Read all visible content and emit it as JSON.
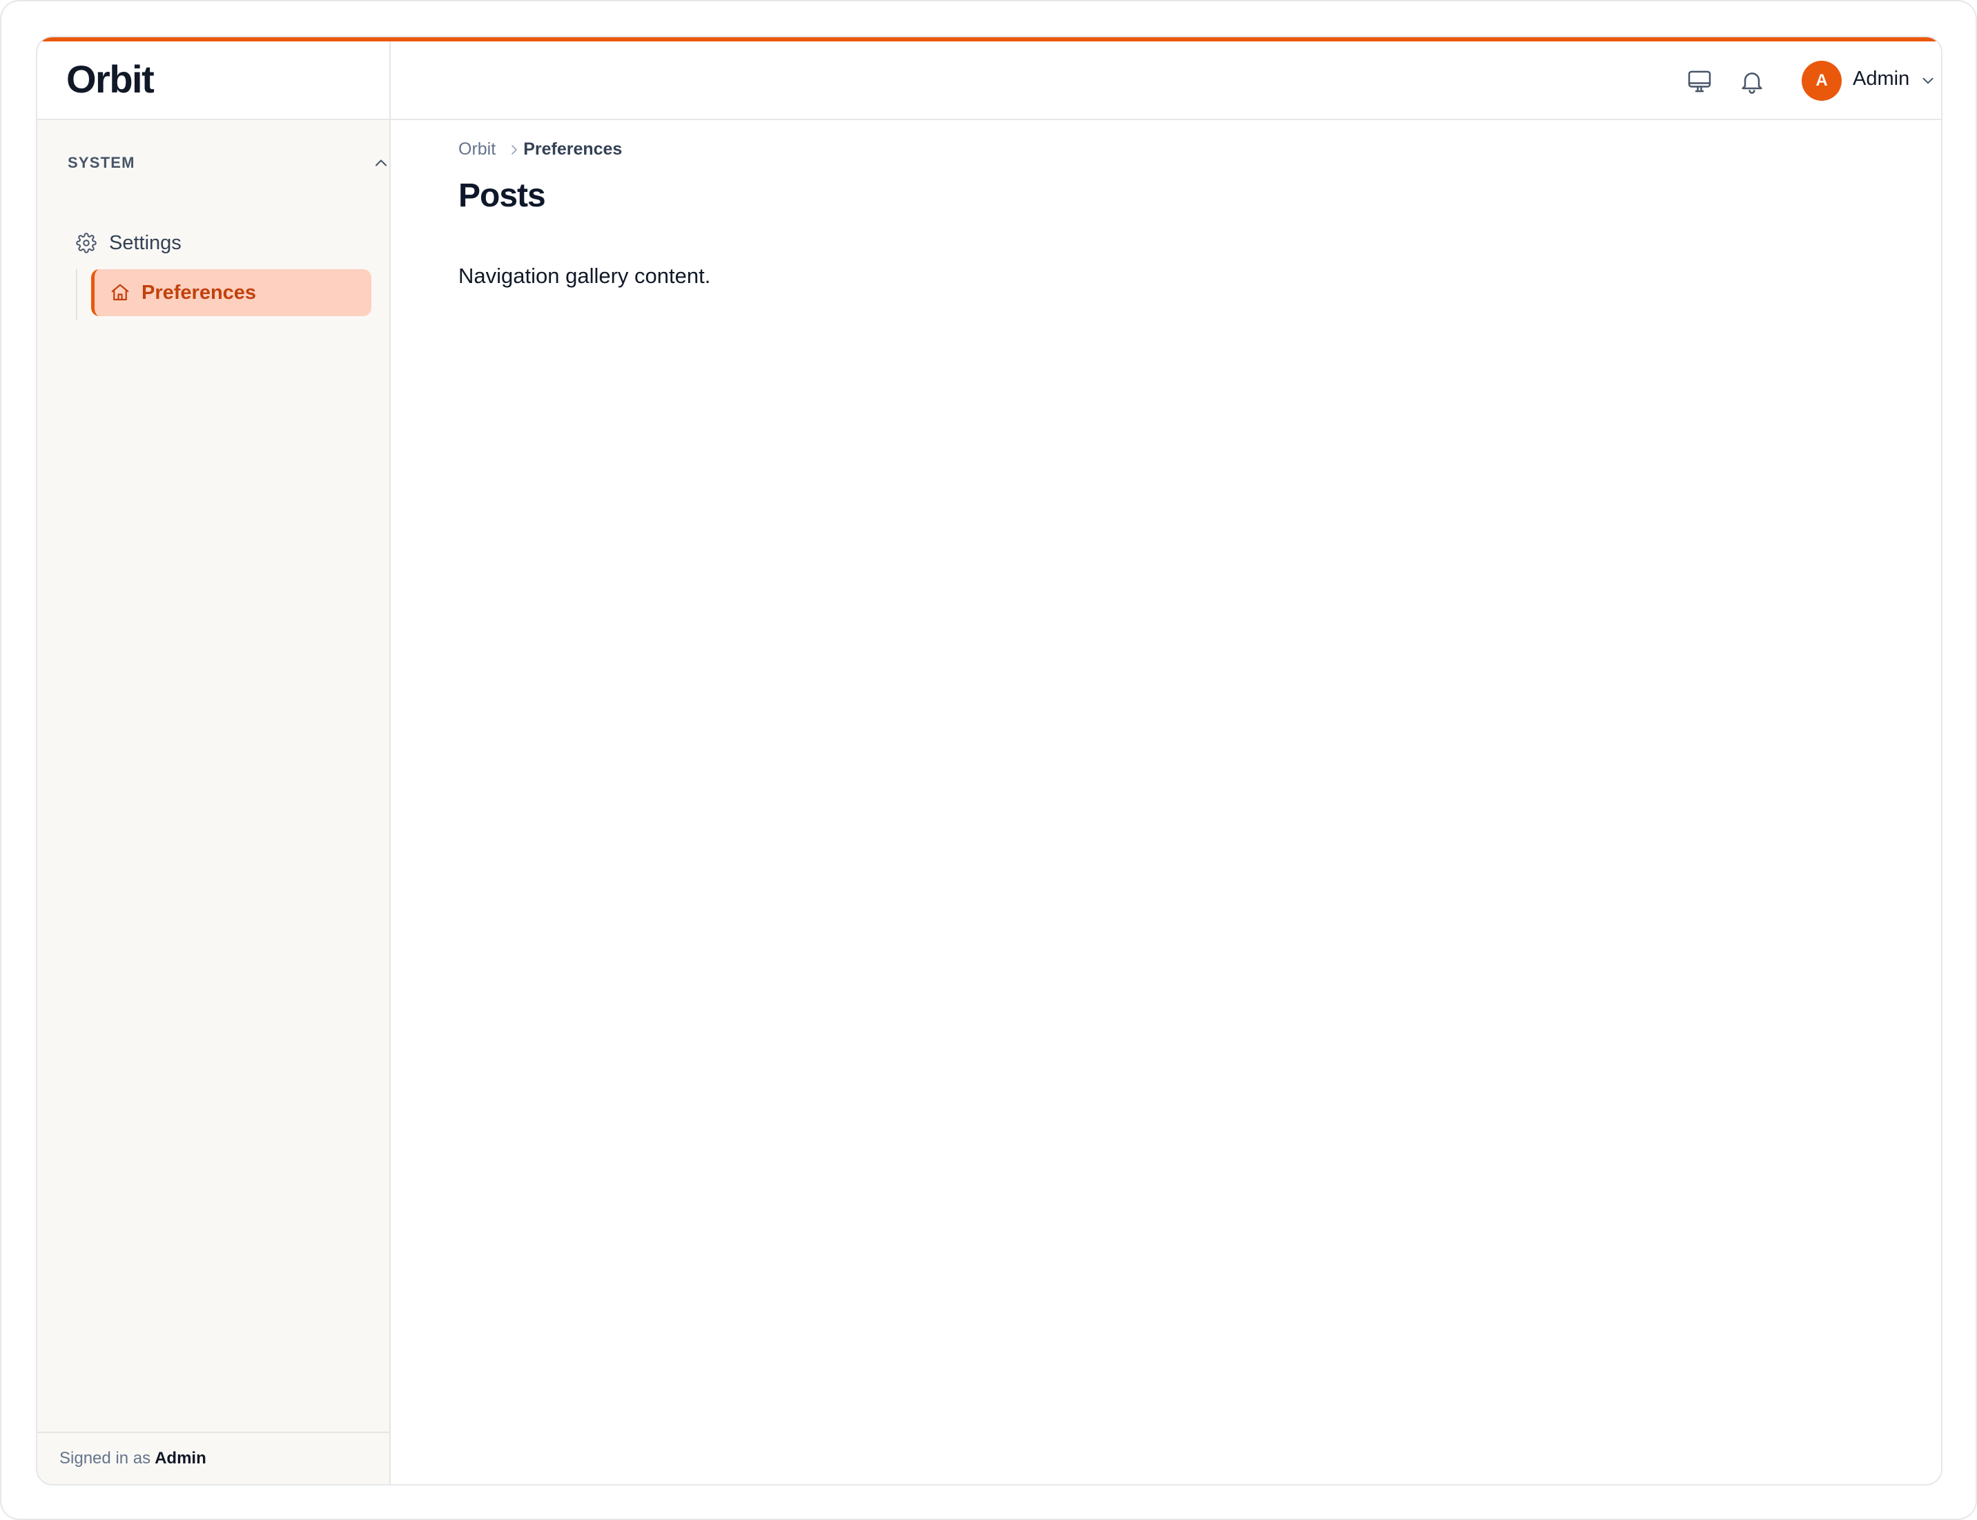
{
  "app": {
    "name": "Orbit",
    "accent_color": "#ea580c"
  },
  "sidebar": {
    "group": {
      "label": "SYSTEM",
      "toggle_icon": "chevron-up-icon",
      "expanded": true
    },
    "items": [
      {
        "label": "Settings",
        "icon": "gear-icon",
        "active": false
      },
      {
        "label": "Preferences",
        "icon": "home-icon",
        "active": true
      }
    ],
    "footer": {
      "prefix": "Signed in as",
      "user": "Admin"
    }
  },
  "header": {
    "icons": [
      "monitor-icon",
      "bell-icon"
    ],
    "user": {
      "initial": "A",
      "name": "Admin",
      "menu_icon": "chevron-down-icon"
    }
  },
  "main": {
    "breadcrumb": {
      "root": "Orbit",
      "current": "Preferences"
    },
    "title": "Posts",
    "content": "Navigation gallery content."
  }
}
